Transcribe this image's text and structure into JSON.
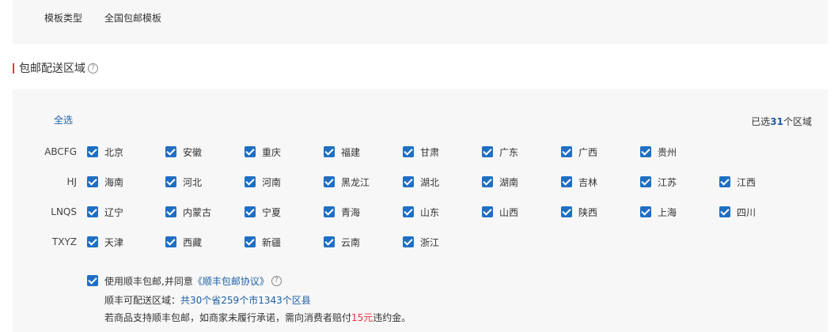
{
  "template": {
    "label": "模板类型",
    "value": "全国包邮模板"
  },
  "section": {
    "title": "包邮配送区域",
    "help": "?"
  },
  "regions": {
    "select_all": "全选",
    "selected_prefix": "已选",
    "selected_count": "31",
    "selected_suffix": "个区域",
    "groups": [
      {
        "label": "ABCFG",
        "provinces": [
          "北京",
          "安徽",
          "重庆",
          "福建",
          "甘肃",
          "广东",
          "广西",
          "贵州"
        ]
      },
      {
        "label": "HJ",
        "provinces": [
          "海南",
          "河北",
          "河南",
          "黑龙江",
          "湖北",
          "湖南",
          "吉林",
          "江苏",
          "江西"
        ]
      },
      {
        "label": "LNQS",
        "provinces": [
          "辽宁",
          "内蒙古",
          "宁夏",
          "青海",
          "山东",
          "山西",
          "陕西",
          "上海",
          "四川"
        ]
      },
      {
        "label": "TXYZ",
        "provinces": [
          "天津",
          "西藏",
          "新疆",
          "云南",
          "浙江"
        ]
      }
    ]
  },
  "agreement": {
    "prefix": "使用顺丰包邮,并同意",
    "link": "《顺丰包邮协议》",
    "help": "?",
    "area_prefix": "顺丰可配送区域：",
    "area_value": "共30个省259个市1343个区县",
    "note_prefix": "若商品支持顺丰包邮，如商家未履行承诺，需向消费者赔付",
    "note_amount": "15元",
    "note_suffix": "违约金。"
  },
  "colors": {
    "accent": "#1f6fc4",
    "link": "#1c5fa6",
    "warning": "#e8333f",
    "panel": "#f7f7f7"
  }
}
